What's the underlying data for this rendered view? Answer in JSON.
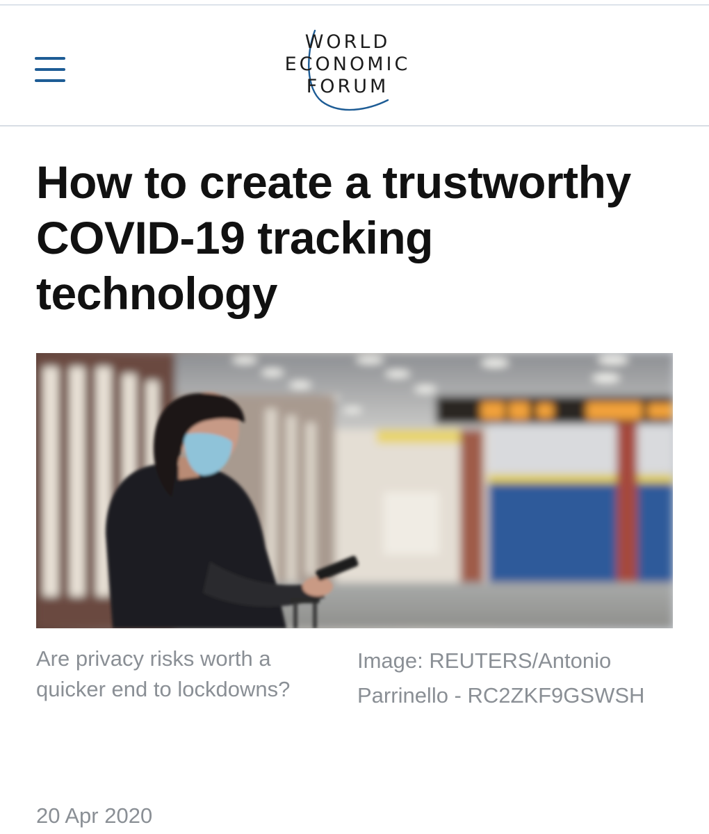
{
  "header": {
    "logo": {
      "line1": "WORLD",
      "line2": "ECONOMIC",
      "line3": "FORUM"
    },
    "menu_icon": "hamburger-menu-icon"
  },
  "article": {
    "title": "How to create a trustworthy COVID-19 tracking technology",
    "image": {
      "caption": "Are privacy risks worth a quicker end to lockdowns?",
      "credit": "Image: REUTERS/Antonio Parrinello - RC2ZKF9GSWSH"
    },
    "date": "20 Apr 2020"
  },
  "colors": {
    "brand_blue": "#1d5c95",
    "headline": "#111111",
    "muted_text": "#8a8f95",
    "divider": "#d8dde4"
  }
}
